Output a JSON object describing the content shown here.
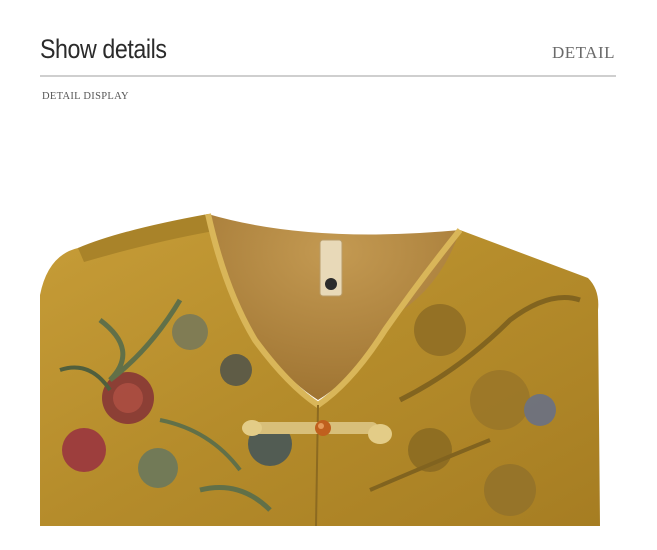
{
  "header": {
    "title": "Show details",
    "tag": "DETAIL",
    "subtitle": "DETAIL DISPLAY"
  },
  "product_photo": {
    "subject": "gold floral jacquard vest neckline with knot button",
    "colors": {
      "fabric": "#b8922e",
      "lining": "#b88a3e",
      "trim": "#c9a34b",
      "flower_red": "#a23a3a",
      "leaf_green": "#5d6f4a"
    }
  }
}
